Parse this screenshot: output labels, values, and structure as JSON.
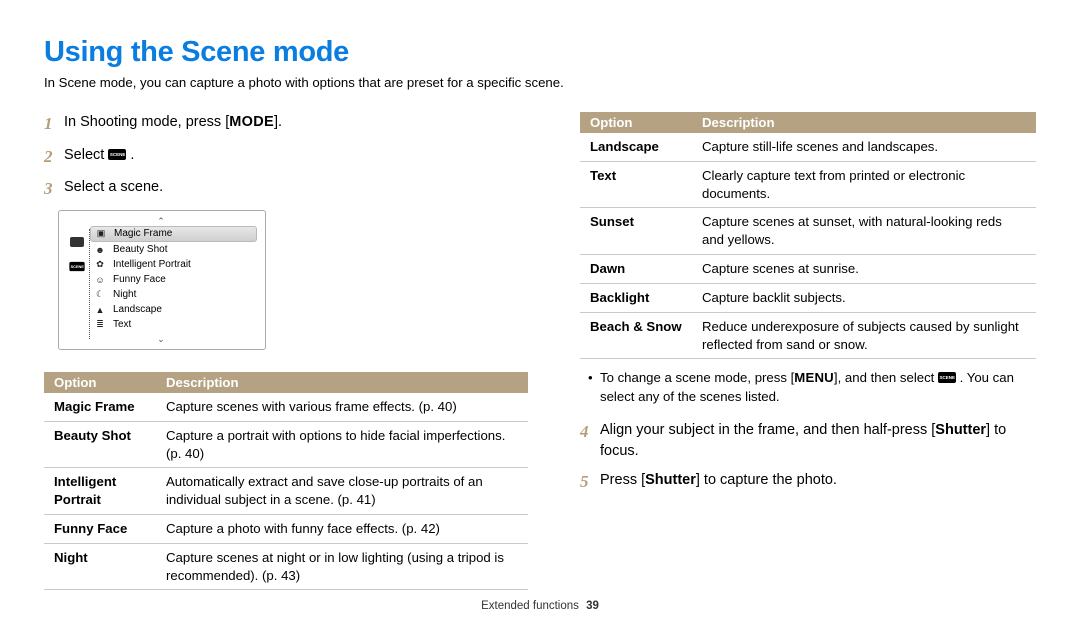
{
  "title": "Using the Scene mode",
  "intro": "In Scene mode, you can capture a photo with options that are preset for a specific scene.",
  "steps": {
    "s1_pre": "In Shooting mode, press [",
    "s1_mode": "MODE",
    "s1_post": "].",
    "s2": "Select ",
    "s2_post": " .",
    "s3": "Select a scene.",
    "s4_pre": "Align your subject in the frame, and then half-press [",
    "s4_btn": "Shutter",
    "s4_post": "] to focus.",
    "s5_pre": "Press [",
    "s5_btn": "Shutter",
    "s5_post": "] to capture the photo."
  },
  "nums": {
    "n1": "1",
    "n2": "2",
    "n3": "3",
    "n4": "4",
    "n5": "5"
  },
  "lcd": {
    "items": [
      "Magic Frame",
      "Beauty Shot",
      "Intelligent Portrait",
      "Funny Face",
      "Night",
      "Landscape",
      "Text"
    ]
  },
  "table_head": {
    "option": "Option",
    "desc": "Description"
  },
  "table_left": [
    {
      "opt": "Magic Frame",
      "desc": "Capture scenes with various frame effects. (p. 40)"
    },
    {
      "opt": "Beauty Shot",
      "desc": "Capture a portrait with options to hide facial imperfections. (p. 40)"
    },
    {
      "opt": "Intelligent Portrait",
      "desc": "Automatically extract and save close-up portraits of an individual subject in a scene. (p. 41)"
    },
    {
      "opt": "Funny Face",
      "desc": "Capture a photo with funny face effects. (p. 42)"
    },
    {
      "opt": "Night",
      "desc": "Capture scenes at night or in low lighting (using a tripod is recommended). (p. 43)"
    }
  ],
  "table_right": [
    {
      "opt": "Landscape",
      "desc": "Capture still-life scenes and landscapes."
    },
    {
      "opt": "Text",
      "desc": "Clearly capture text from printed or electronic documents."
    },
    {
      "opt": "Sunset",
      "desc": "Capture scenes at sunset, with natural-looking reds and yellows."
    },
    {
      "opt": "Dawn",
      "desc": "Capture scenes at sunrise."
    },
    {
      "opt": "Backlight",
      "desc": "Capture backlit subjects."
    },
    {
      "opt": "Beach & Snow",
      "desc": "Reduce underexposure of subjects caused by sunlight reflected from sand or snow."
    }
  ],
  "bullet": {
    "pre": "To change a scene mode, press [",
    "menu": "MENU",
    "mid": "], and then select ",
    "post": " . You can select any of the scenes listed."
  },
  "footer": {
    "section": "Extended functions",
    "page": "39"
  }
}
